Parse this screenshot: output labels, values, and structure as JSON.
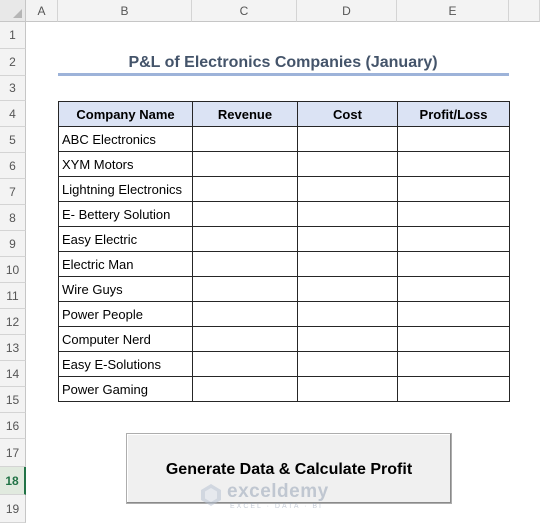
{
  "columns": [
    "A",
    "B",
    "C",
    "D",
    "E"
  ],
  "rows": [
    "1",
    "2",
    "3",
    "4",
    "5",
    "6",
    "7",
    "8",
    "9",
    "10",
    "11",
    "12",
    "13",
    "14",
    "15",
    "16",
    "17",
    "18",
    "19"
  ],
  "active_row": "18",
  "sheet": {
    "title": "P&L of Electronics Companies (January)",
    "table": {
      "headers": [
        "Company Name",
        "Revenue",
        "Cost",
        "Profit/Loss"
      ],
      "companies": [
        "ABC Electronics",
        "XYM Motors",
        "Lightning Electronics",
        "E- Bettery Solution",
        "Easy Electric",
        "Electric Man",
        "Wire Guys",
        "Power People",
        "Computer Nerd",
        "Easy E-Solutions",
        "Power Gaming"
      ]
    },
    "button_label": "Generate Data & Calculate Profit"
  },
  "watermark": {
    "name": "exceldemy",
    "tagline": "EXCEL · DATA · BI"
  },
  "colors": {
    "header_fill": "#dbe3f4",
    "title_text": "#44546a",
    "title_rule": "#9db3d9",
    "active_row": "#217346"
  }
}
